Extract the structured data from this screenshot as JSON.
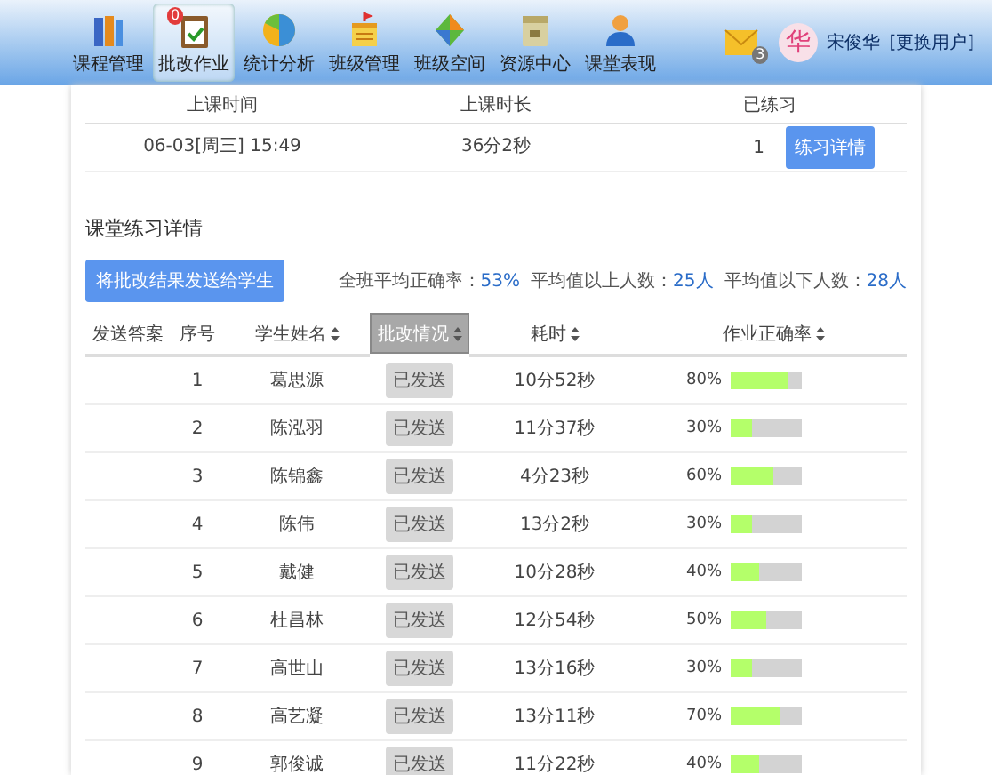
{
  "nav": {
    "items": [
      {
        "label": "课程管理",
        "selected": false
      },
      {
        "label": "批改作业",
        "selected": true,
        "badge": "0"
      },
      {
        "label": "统计分析",
        "selected": false
      },
      {
        "label": "班级管理",
        "selected": false
      },
      {
        "label": "班级空间",
        "selected": false
      },
      {
        "label": "资源中心",
        "selected": false
      },
      {
        "label": "课堂表现",
        "selected": false
      }
    ],
    "mail_badge": "3",
    "user": {
      "avatar": "华",
      "name": "宋俊华",
      "switch": "[更换用户]"
    }
  },
  "summary": {
    "columns": [
      "上课时间",
      "上课时长",
      "已练习"
    ],
    "row": {
      "time": "06-03[周三] 15:49",
      "duration": "36分2秒",
      "practiced": "1",
      "button": "练习详情"
    }
  },
  "section_title": "课堂练习详情",
  "send_button": "将批改结果发送给学生",
  "stats": [
    {
      "label": "全班平均正确率：",
      "value": "53%"
    },
    {
      "label": "平均值以上人数：",
      "value": "25人"
    },
    {
      "label": "平均值以下人数：",
      "value": "28人"
    }
  ],
  "table": {
    "columns": [
      {
        "label": "发送答案",
        "sortable": false,
        "selected": false
      },
      {
        "label": "序号",
        "sortable": false,
        "selected": false
      },
      {
        "label": "学生姓名",
        "sortable": true,
        "selected": false
      },
      {
        "label": "批改情况",
        "sortable": true,
        "selected": true
      },
      {
        "label": "耗时",
        "sortable": true,
        "selected": false
      },
      {
        "label": "作业正确率",
        "sortable": true,
        "selected": false
      }
    ],
    "rows": [
      {
        "index": "1",
        "name": "葛思源",
        "status": "已发送",
        "time": "10分52秒",
        "rate": "80%",
        "level": 0.8
      },
      {
        "index": "2",
        "name": "陈泓羽",
        "status": "已发送",
        "time": "11分37秒",
        "rate": "30%",
        "level": 0.3
      },
      {
        "index": "3",
        "name": "陈锦鑫",
        "status": "已发送",
        "time": "4分23秒",
        "rate": "60%",
        "level": 0.6
      },
      {
        "index": "4",
        "name": "陈伟",
        "status": "已发送",
        "time": "13分2秒",
        "rate": "30%",
        "level": 0.3
      },
      {
        "index": "5",
        "name": "戴健",
        "status": "已发送",
        "time": "10分28秒",
        "rate": "40%",
        "level": 0.4
      },
      {
        "index": "6",
        "name": "杜昌林",
        "status": "已发送",
        "time": "12分54秒",
        "rate": "50%",
        "level": 0.5
      },
      {
        "index": "7",
        "name": "高世山",
        "status": "已发送",
        "time": "13分16秒",
        "rate": "30%",
        "level": 0.3
      },
      {
        "index": "8",
        "name": "高艺凝",
        "status": "已发送",
        "time": "13分11秒",
        "rate": "70%",
        "level": 0.7
      },
      {
        "index": "9",
        "name": "郭俊诚",
        "status": "已发送",
        "time": "11分22秒",
        "rate": "40%",
        "level": 0.4
      }
    ]
  }
}
